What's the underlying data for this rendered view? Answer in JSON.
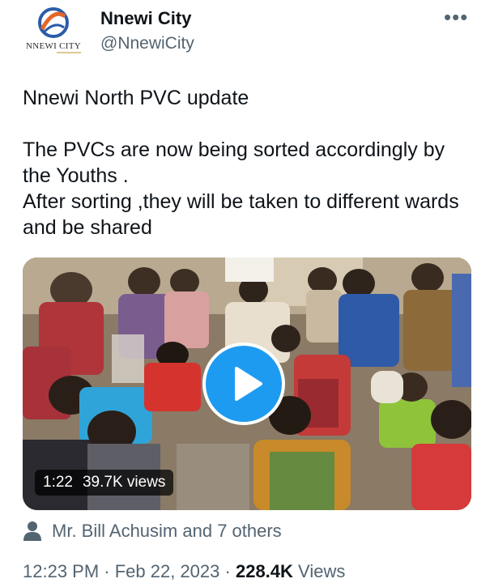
{
  "account": {
    "logo_text": "NNEWI CITY",
    "display_name": "Nnewi City",
    "handle": "@NnewiCity"
  },
  "menu": {
    "more_label": "•••"
  },
  "tweet": {
    "title_line": "Nnewi North PVC update",
    "body_line1": "The PVCs are now being sorted accordingly by the Youths .",
    "body_line2": "After sorting ,they will be taken to different wards and be shared"
  },
  "video": {
    "duration": "1:22",
    "views": "39.7K views"
  },
  "tagged": {
    "text": "Mr. Bill Achusim and 7 others"
  },
  "meta": {
    "time": "12:23 PM",
    "separator": " · ",
    "date": "Feb 22, 2023",
    "view_count": "228.4K",
    "views_label": "Views"
  },
  "colors": {
    "accent": "#1d9bf0",
    "muted": "#536471",
    "text": "#0f1419"
  },
  "icons": [
    "nnewi-city-logo",
    "more-icon",
    "play-icon",
    "person-icon"
  ]
}
